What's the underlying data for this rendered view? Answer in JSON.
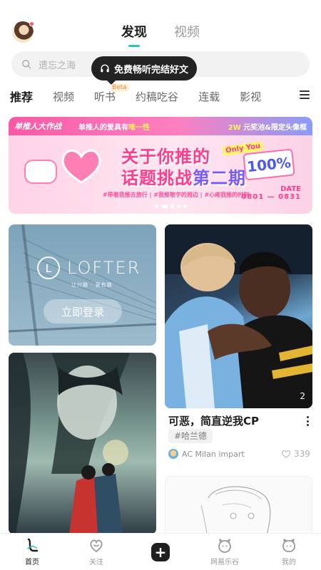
{
  "header": {
    "tabs": [
      {
        "label": "发现",
        "active": true
      },
      {
        "label": "视频",
        "active": false
      }
    ],
    "accent_color": "#2bc3b2"
  },
  "search": {
    "placeholder": "遗忘之海",
    "icon": "search-icon"
  },
  "tooltip": {
    "text": "免费畅听完结好文",
    "icon": "headphones-icon"
  },
  "categories": {
    "items": [
      {
        "label": "推荐",
        "active": true
      },
      {
        "label": "视频"
      },
      {
        "label": "听书",
        "badge": "Beta"
      },
      {
        "label": "约稿吃谷"
      },
      {
        "label": "连载"
      },
      {
        "label": "影视"
      }
    ],
    "menu_icon": "menu-icon"
  },
  "banner": {
    "logo_text": "单推人大作战",
    "top_text_a": "单推人的爱具有",
    "top_text_b": "唯一性",
    "top_right_a": "2W",
    "top_right_b": "元奖池&限定头像框",
    "title_line1": "关于你推的",
    "title_line2_a": "话题挑战",
    "title_line2_b": "第二期",
    "only_you": "Only You",
    "percent": "100%",
    "tags": "#带着我推去旅行 | #我推敬字的周边 | #心疼我推的时刻",
    "date_label": "DATE",
    "date_value": "0801 — 0831",
    "slide_count": 5,
    "active_slide": 1
  },
  "login_card": {
    "brand": "LOFTER",
    "tagline": "让兴趣 · 更有趣",
    "login_label": "立即登录"
  },
  "photo_post": {
    "image_count": "2",
    "title": "可恶，简直逆我CP",
    "tag": "#哈兰德",
    "author": "AC Milan impart",
    "likes": "339"
  },
  "bottom_nav": {
    "items": [
      {
        "label": "首页",
        "icon": "home-icon",
        "active": true
      },
      {
        "label": "关注",
        "icon": "follow-icon"
      },
      {
        "label": "",
        "icon": "plus-icon"
      },
      {
        "label": "网易乐谷",
        "icon": "mascot-icon"
      },
      {
        "label": "我的",
        "icon": "profile-icon"
      }
    ]
  }
}
